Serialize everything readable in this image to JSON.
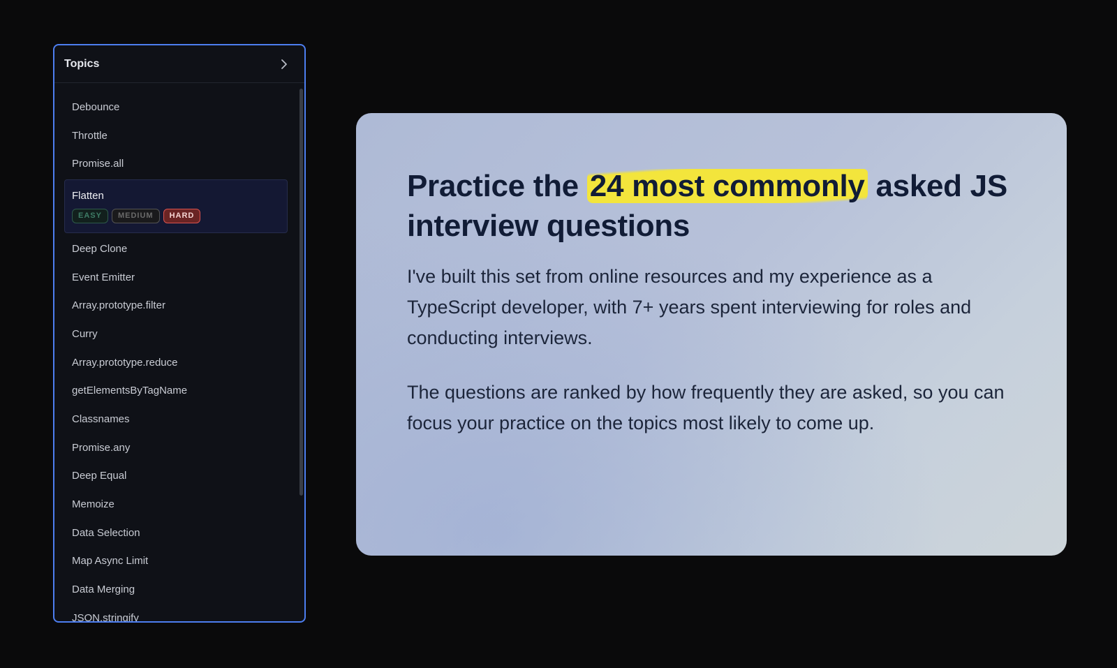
{
  "topics_panel": {
    "title": "Topics",
    "items": [
      {
        "label": "Debounce"
      },
      {
        "label": "Throttle"
      },
      {
        "label": "Promise.all"
      },
      {
        "label": "Flatten",
        "selected": true,
        "badges": [
          "EASY",
          "MEDIUM",
          "HARD"
        ],
        "active_badge": "HARD"
      },
      {
        "label": "Deep Clone"
      },
      {
        "label": "Event Emitter"
      },
      {
        "label": "Array.prototype.filter"
      },
      {
        "label": "Curry"
      },
      {
        "label": "Array.prototype.reduce"
      },
      {
        "label": "getElementsByTagName"
      },
      {
        "label": "Classnames"
      },
      {
        "label": "Promise.any"
      },
      {
        "label": "Deep Equal"
      },
      {
        "label": "Memoize"
      },
      {
        "label": "Data Selection"
      },
      {
        "label": "Map Async Limit"
      },
      {
        "label": "Data Merging"
      },
      {
        "label": "JSON.stringify"
      }
    ]
  },
  "info_card": {
    "headline_before": "Practice the",
    "headline_highlight": "24 most commonly",
    "headline_after": "asked JS interview questions",
    "paragraph_1": "I've built this set from online resources and my experience as a TypeScript developer, with 7+ years spent interviewing for roles and conducting interviews.",
    "paragraph_2": "The questions are ranked by how frequently they are asked, so you can focus your practice on the topics most likely to come up."
  },
  "colors": {
    "panel_border": "#4d7ef0",
    "highlight": "#f3e53c",
    "hard_badge": "#d9534f"
  },
  "icons": {
    "expand": "chevron-right-icon"
  }
}
